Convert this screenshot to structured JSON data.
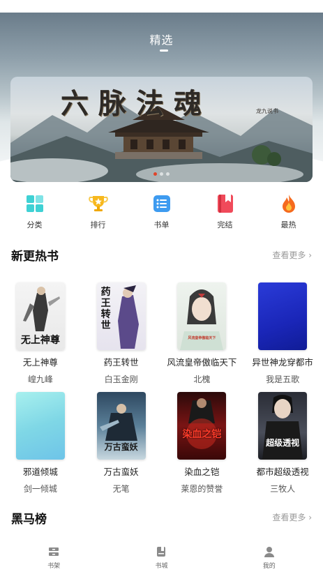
{
  "header": {
    "tab_label": "精选"
  },
  "banner": {
    "title": "六脉法魂",
    "subtitle": "龙九说书"
  },
  "categories": [
    {
      "label": "分类",
      "icon": "grid-icon",
      "color": "#3fd1d4"
    },
    {
      "label": "排行",
      "icon": "trophy-icon",
      "color": "#f7b81e"
    },
    {
      "label": "书单",
      "icon": "list-icon",
      "color": "#3e9bf0"
    },
    {
      "label": "完结",
      "icon": "bookmark-icon",
      "color": "#f04a5a"
    },
    {
      "label": "最热",
      "icon": "flame-icon",
      "color": "#f56a1e"
    }
  ],
  "section_new": {
    "title": "新更热书",
    "more": "查看更多 ›"
  },
  "books": [
    {
      "title": "无上神尊",
      "author": "崲九峰",
      "cover_text": "无上神尊"
    },
    {
      "title": "药王转世",
      "author": "白玉金刚",
      "cover_text": "药王转世"
    },
    {
      "title": "风流皇帝傲临天下",
      "author": "北槐",
      "cover_text": "风流皇帝傲临天下"
    },
    {
      "title": "异世神龙穿都市",
      "author": "我是五歌",
      "cover_text": ""
    },
    {
      "title": "邪道倾城",
      "author": "剑一倾城",
      "cover_text": ""
    },
    {
      "title": "万古蛮妖",
      "author": "无笔",
      "cover_text": "万古蛮妖"
    },
    {
      "title": "染血之铠",
      "author": "莱恩的赞誉",
      "cover_text": "染血之铠"
    },
    {
      "title": "都市超级透视",
      "author": "三牧人",
      "cover_text": "超级透视"
    }
  ],
  "section_dark": {
    "title": "黑马榜",
    "more": "查看更多 ›"
  },
  "bottom_nav": [
    {
      "label": "书架",
      "icon": "bookshelf-icon"
    },
    {
      "label": "书城",
      "icon": "bookstore-icon"
    },
    {
      "label": "我的",
      "icon": "profile-icon"
    }
  ]
}
